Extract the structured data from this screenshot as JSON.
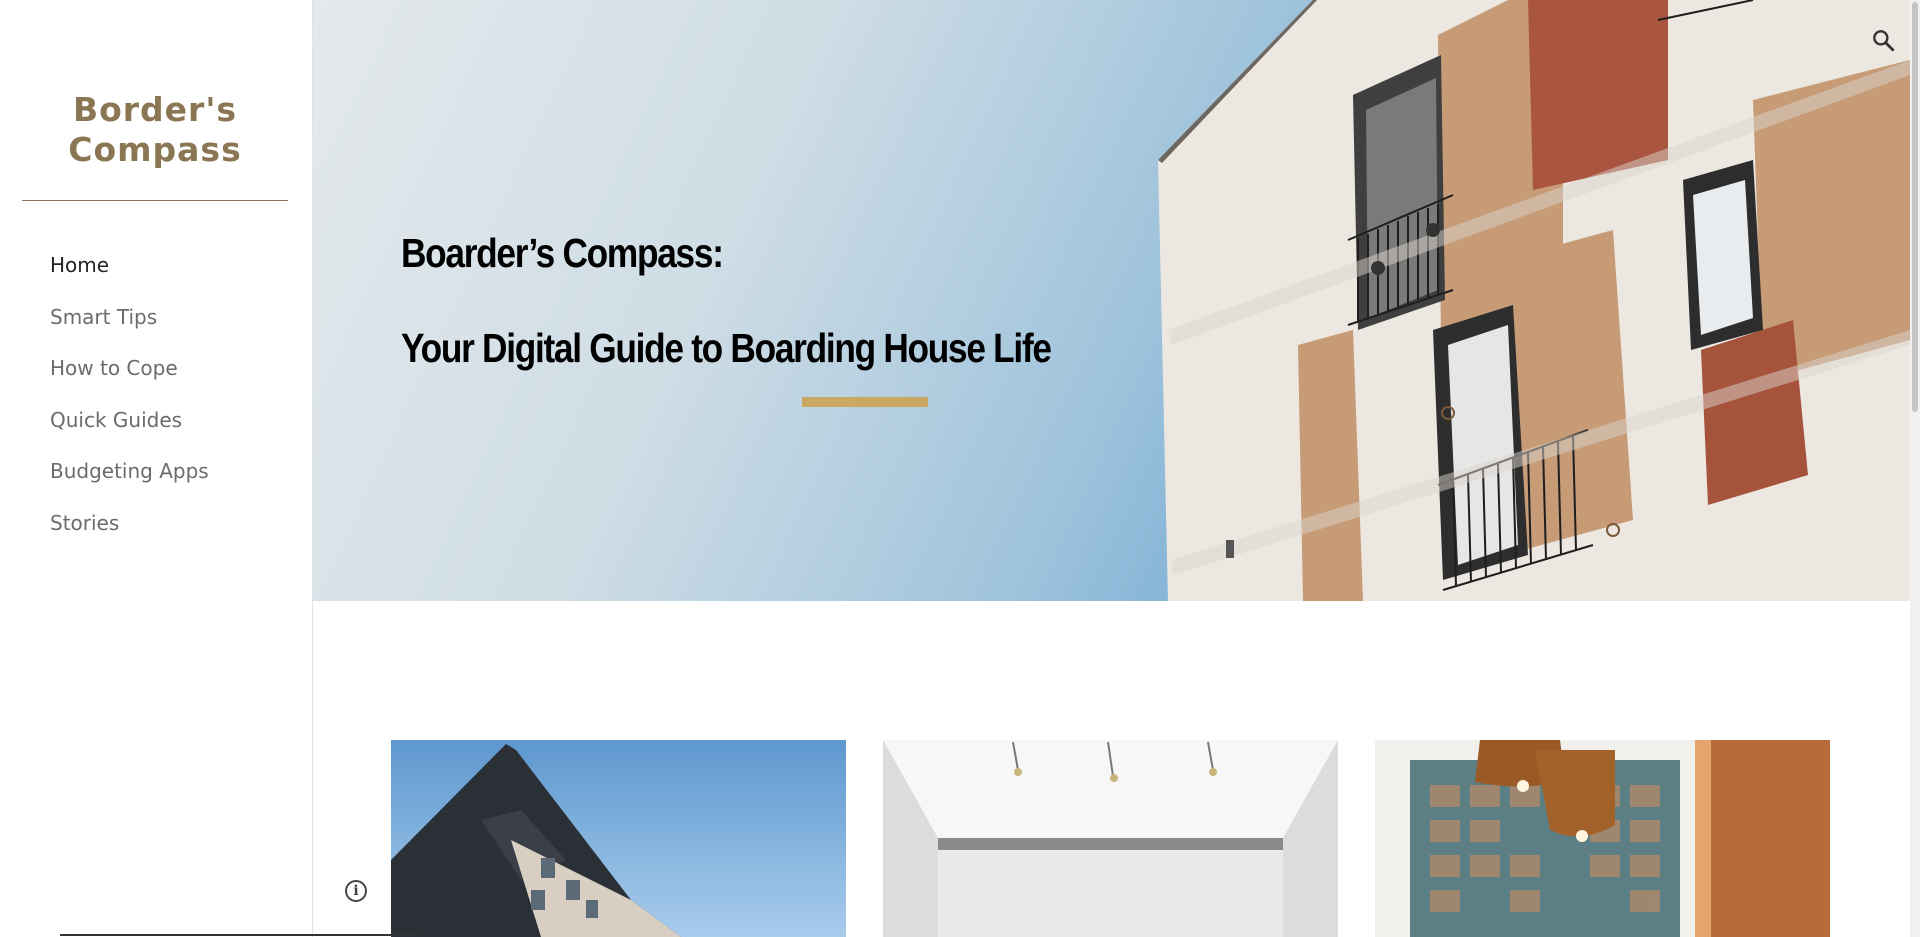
{
  "site": {
    "title_line1": "Border's",
    "title_line2": "Compass"
  },
  "nav": {
    "items": [
      {
        "label": "Home",
        "active": true
      },
      {
        "label": "Smart Tips",
        "active": false
      },
      {
        "label": "How to Cope",
        "active": false
      },
      {
        "label": "Quick Guides",
        "active": false
      },
      {
        "label": "Budgeting Apps",
        "active": false
      },
      {
        "label": "Stories",
        "active": false
      }
    ]
  },
  "hero": {
    "heading_line1": "Boarder’s Compass:",
    "heading_line2": "Your Digital Guide to Boarding House Life"
  },
  "icons": {
    "search": "search-icon",
    "info": "info-icon"
  },
  "colors": {
    "brand": "#8a7653",
    "accent": "#c9a863",
    "sky": "#6ea6d1"
  },
  "cards": [
    {
      "image": "apartment-building-photo"
    },
    {
      "image": "white-room-interior-photo"
    },
    {
      "image": "pendant-lamps-photo"
    }
  ]
}
